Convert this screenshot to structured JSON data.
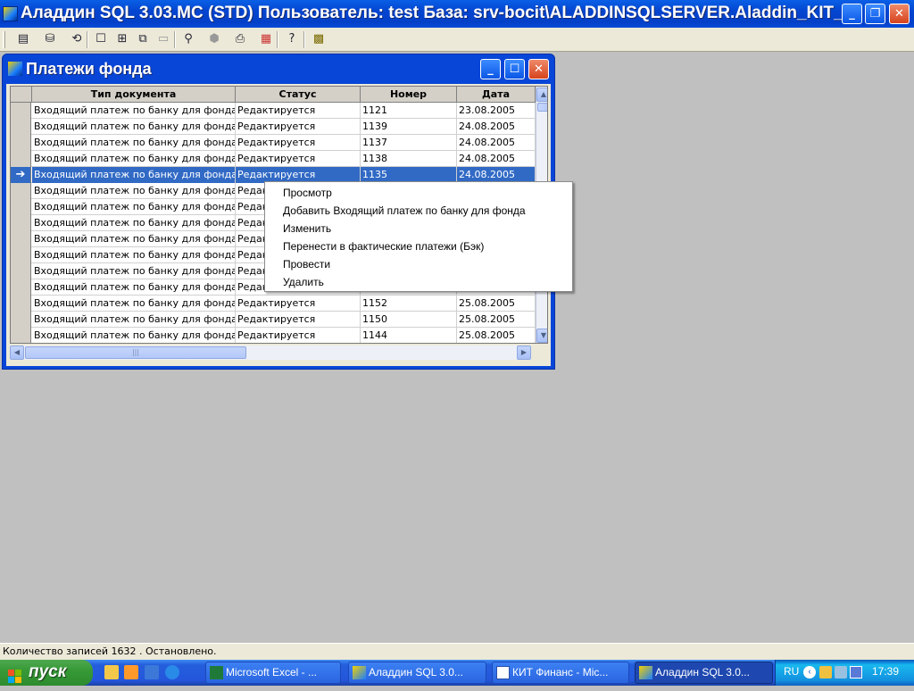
{
  "app": {
    "title": "Аладдин SQL 3.03.MC (STD)  Пользователь: test База: srv-bocit\\ALADDINSQLSERVER.Aladdin_KIT_..."
  },
  "window": {
    "title": "Платежи фонда"
  },
  "grid": {
    "columns": [
      "Тип документа",
      "Статус",
      "Номер",
      "Дата"
    ],
    "rows": [
      {
        "type": "Входящий платеж по банку для фонда",
        "status": "Редактируется",
        "number": "1121",
        "date": "23.08.2005"
      },
      {
        "type": "Входящий платеж по банку для фонда",
        "status": "Редактируется",
        "number": "1139",
        "date": "24.08.2005"
      },
      {
        "type": "Входящий платеж по банку для фонда",
        "status": "Редактируется",
        "number": "1137",
        "date": "24.08.2005"
      },
      {
        "type": "Входящий платеж по банку для фонда",
        "status": "Редактируется",
        "number": "1138",
        "date": "24.08.2005"
      },
      {
        "type": "Входящий платеж по банку для фонда",
        "status": "Редактируется",
        "number": "1135",
        "date": "24.08.2005",
        "selected": true
      },
      {
        "type": "Входящий платеж по банку для фонда",
        "status": "Редакт",
        "number": "",
        "date": ""
      },
      {
        "type": "Входящий платеж по банку для фонда",
        "status": "Редакт",
        "number": "",
        "date": ""
      },
      {
        "type": "Входящий платеж по банку для фонда",
        "status": "Редакт",
        "number": "",
        "date": ""
      },
      {
        "type": "Входящий платеж по банку для фонда",
        "status": "Редакт",
        "number": "",
        "date": ""
      },
      {
        "type": "Входящий платеж по банку для фонда",
        "status": "Редакт",
        "number": "",
        "date": ""
      },
      {
        "type": "Входящий платеж по банку для фонда",
        "status": "Редакт",
        "number": "",
        "date": ""
      },
      {
        "type": "Входящий платеж по банку для фонда",
        "status": "Редакт",
        "number": "",
        "date": ""
      },
      {
        "type": "Входящий платеж по банку для фонда",
        "status": "Редактируется",
        "number": "1152",
        "date": "25.08.2005"
      },
      {
        "type": "Входящий платеж по банку для фонда",
        "status": "Редактируется",
        "number": "1150",
        "date": "25.08.2005"
      },
      {
        "type": "Входящий платеж по банку для фонда",
        "status": "Редактируется",
        "number": "1144",
        "date": "25.08.2005"
      }
    ]
  },
  "context_menu": {
    "items": [
      "Просмотр",
      "Добавить Входящий платеж по банку для фонда",
      "Изменить",
      "Перенести в фактические платежи (Бэк)",
      "Провести",
      "Удалить"
    ]
  },
  "status_bar": {
    "text": "Количество записей 1632 . Остановлено."
  },
  "taskbar": {
    "start_label": "пуск",
    "tasks": [
      {
        "label": "Microsoft Excel - ...",
        "icon": "excel-icon"
      },
      {
        "label": "Аладдин SQL 3.0...",
        "icon": "aladdin-icon"
      },
      {
        "label": "КИТ Финанс - Mic...",
        "icon": "word-icon"
      },
      {
        "label": "Аладдин SQL 3.0...",
        "icon": "aladdin-icon",
        "active": true
      }
    ],
    "language": "RU",
    "clock": "17:39"
  },
  "colors": {
    "selection": "#316ac5",
    "titlebar": "#0a5fe6",
    "start": "#379a37"
  }
}
